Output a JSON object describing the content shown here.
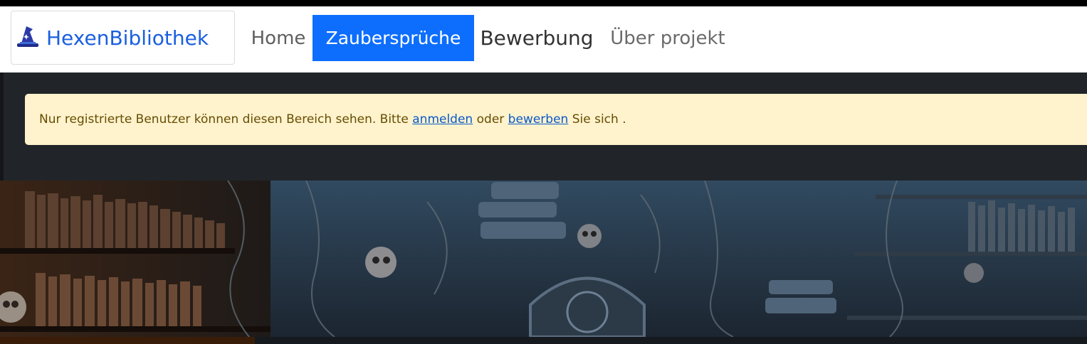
{
  "brand": {
    "name": "HexenBibliothek",
    "icon": "witch-hat-icon"
  },
  "nav": {
    "items": [
      {
        "label": "Home",
        "active": false
      },
      {
        "label": "Zaubersprüche",
        "active": true
      },
      {
        "label": "Bewerbung",
        "active": false
      },
      {
        "label": "Über projekt",
        "active": false
      }
    ]
  },
  "alert": {
    "text_before": "Nur registrierte Benutzer können diesen Bereich sehen. Bitte ",
    "login_link": "anmelden",
    "text_middle": " oder ",
    "apply_link": "bewerben",
    "text_after": " Sie sich ."
  },
  "colors": {
    "brand": "#1a5fe0",
    "nav_active_bg": "#0d6efd",
    "alert_bg": "#fff3cd",
    "alert_text": "#664d03",
    "panel_bg": "#212529"
  }
}
